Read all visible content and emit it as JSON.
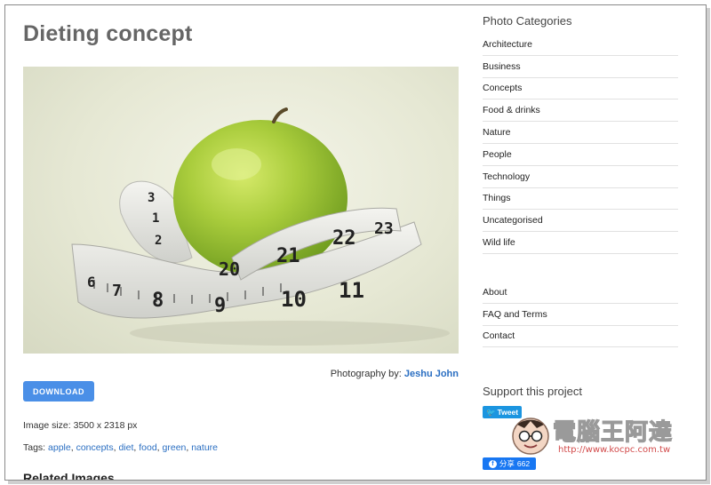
{
  "page": {
    "title": "Dieting concept",
    "photo_alt": "Green apple wrapped in measuring tape",
    "credit_prefix": "Photography by:",
    "credit_name": "Jeshu John",
    "download_label": "DOWNLOAD",
    "image_size": "Image size: 3500 x 2318 px",
    "tags_label": "Tags:",
    "tags": [
      "apple",
      "concepts",
      "diet",
      "food",
      "green",
      "nature"
    ],
    "related_title": "Related Images"
  },
  "sidebar": {
    "categories_title": "Photo Categories",
    "categories": [
      "Architecture",
      "Business",
      "Concepts",
      "Food & drinks",
      "Nature",
      "People",
      "Technology",
      "Things",
      "Uncategorised",
      "Wild life"
    ],
    "pages": [
      "About",
      "FAQ and Terms",
      "Contact"
    ],
    "support_title": "Support this project",
    "tweet_label": "Tweet",
    "share_label": "分享",
    "share_count": "662"
  },
  "watermark": {
    "text": "電腦王阿達",
    "url": "http://www.kocpc.com.tw"
  },
  "tape_numbers": [
    "6",
    "7",
    "8",
    "9",
    "10",
    "11",
    "20",
    "21",
    "22",
    "23",
    "3",
    "1",
    "2"
  ],
  "colors": {
    "link": "#2b6fc2",
    "button": "#4a8fe7",
    "tweet": "#1b95e0",
    "facebook": "#1877f2",
    "apple": "#9ec23a"
  }
}
